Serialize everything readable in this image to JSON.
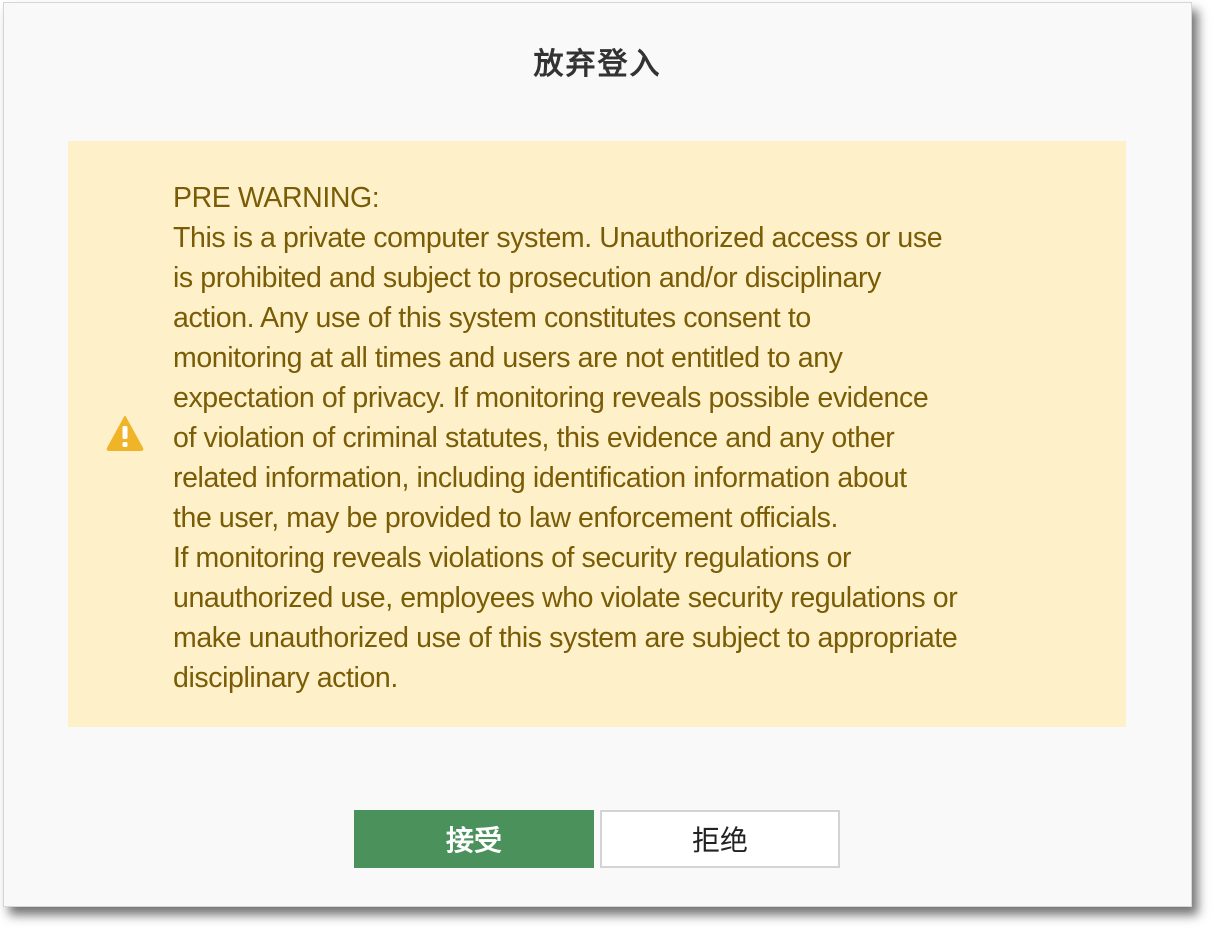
{
  "dialog": {
    "title": "放弃登入"
  },
  "warning": {
    "icon": "warning-triangle-icon",
    "icon_color": "#f0b429",
    "background_color": "#fef1c9",
    "text_color": "#7a5c06",
    "lines": [
      "PRE WARNING:",
      "This is a private computer system. Unauthorized access or use",
      "is prohibited and subject to prosecution and/or disciplinary",
      "action. Any use of this system constitutes consent to",
      "monitoring at all times and users are not entitled to any",
      "expectation of privacy. If monitoring reveals possible evidence",
      "of violation of criminal statutes, this evidence and any other",
      "related information, including identification information about",
      "the user, may be provided to law enforcement officials.",
      "If monitoring reveals violations of security regulations or",
      "unauthorized use, employees who violate security regulations or",
      "make unauthorized use of this system are subject to appropriate",
      "disciplinary action."
    ]
  },
  "buttons": {
    "accept_label": "接受",
    "reject_label": "拒绝",
    "accept_color": "#4a915b"
  }
}
